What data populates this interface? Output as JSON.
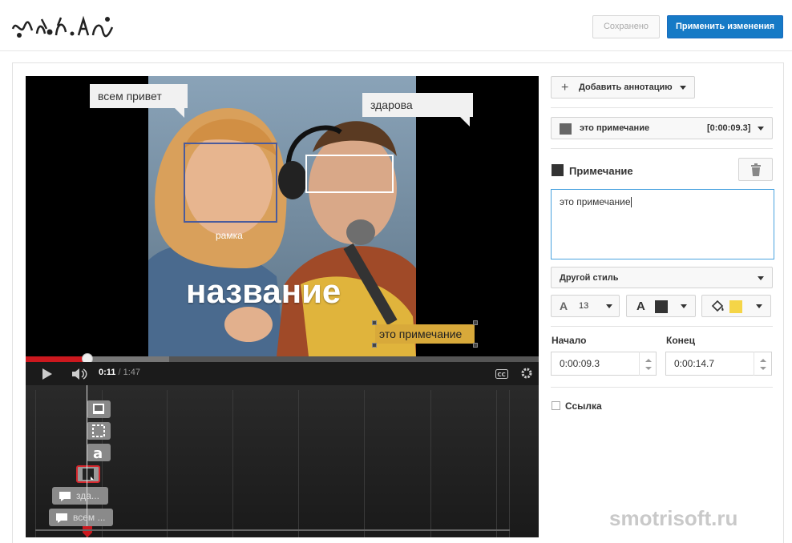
{
  "header": {
    "saved_label": "Сохранено",
    "apply_label": "Применить изменения"
  },
  "video": {
    "annotations": {
      "speech1": "всем привет",
      "speech2": "здарова",
      "frame_label": "рамка",
      "title": "название",
      "note": "это примечание"
    },
    "current_time": "0:11",
    "separator": " / ",
    "duration": "1:47",
    "progress_played_fraction": 0.12,
    "progress_buffered_fraction": 0.28
  },
  "timeline": {
    "chips": [
      {
        "label": "зда..."
      },
      {
        "label": "всем ..."
      }
    ]
  },
  "sidebar": {
    "add_annotation_label": "Добавить аннотацию",
    "selected_annotation": {
      "label": "это примечание",
      "time": "[0:00:09.3]"
    },
    "section_title": "Примечание",
    "note_text": "это примечание",
    "style_label": "Другой стиль",
    "font_size": "13",
    "text_color": "#333333",
    "bg_color": "#f5d547",
    "start_label": "Начало",
    "end_label": "Конец",
    "start_value": "0:00:09.3",
    "end_value": "0:00:14.7",
    "link_label": "Ссылка",
    "link_checked": false
  },
  "watermark": "smotrisoft.ru",
  "colors": {
    "accent": "#167ac6",
    "progress": "#cc181e",
    "focus": "#4aa3df"
  }
}
